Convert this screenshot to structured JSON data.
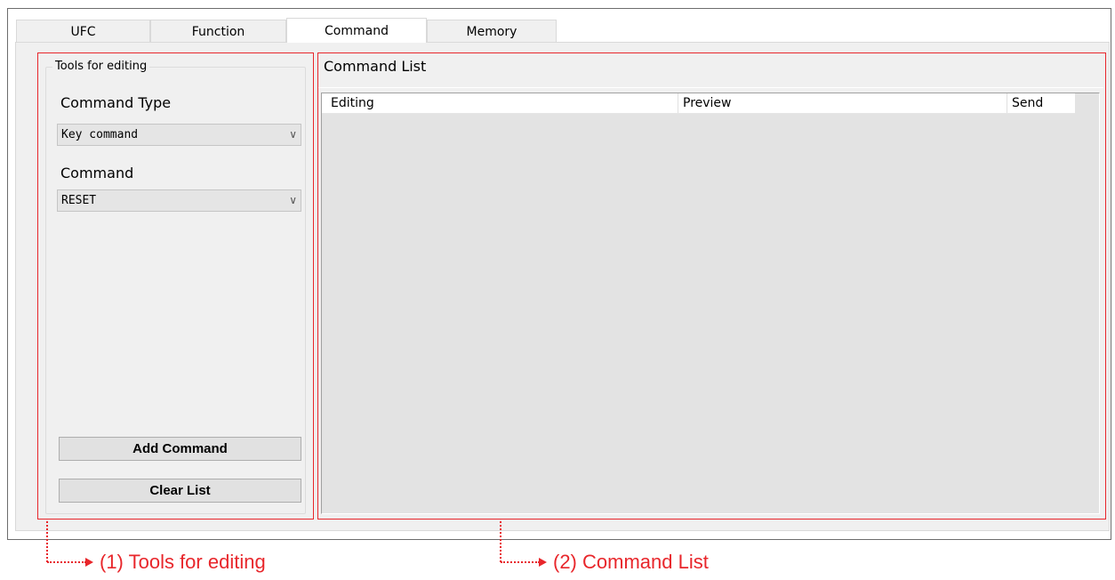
{
  "tabs": [
    {
      "label": "UFC",
      "active": false
    },
    {
      "label": "Function",
      "active": false
    },
    {
      "label": "Command",
      "active": true
    },
    {
      "label": "Memory",
      "active": false
    }
  ],
  "tools": {
    "group_title": "Tools for editing",
    "command_type_label": "Command Type",
    "command_type_value": "Key command",
    "command_label": "Command",
    "command_value": "RESET",
    "add_button": "Add Command",
    "clear_button": "Clear List"
  },
  "command_list": {
    "title": "Command List",
    "columns": [
      "Editing",
      "Preview",
      "Send"
    ]
  },
  "annotations": {
    "tools": "(1) Tools for editing",
    "list": "(2) Command List",
    "color": "#e8262b"
  },
  "icons": {
    "dropdown": "chevron-down-icon"
  }
}
